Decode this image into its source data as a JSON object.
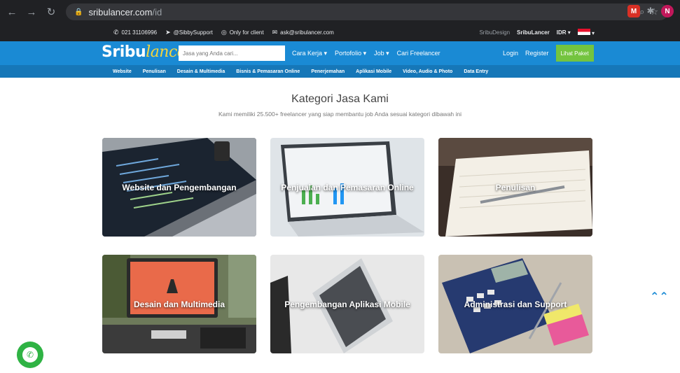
{
  "browser": {
    "url_host": "sribulancer.com",
    "url_path": "/id",
    "ext_avatar": "N"
  },
  "topbar": {
    "phone": "021 31106996",
    "telegram": "@SibbySupport",
    "whatsapp": "Only for client",
    "email": "ask@sribulancer.com",
    "sribudesign": "SribuDesign",
    "sribulancer": "SribuLancer",
    "currency": "IDR ▾"
  },
  "nav": {
    "logo_sribu": "Sribu",
    "logo_lancer": "lancer",
    "search_placeholder": "Jasa yang Anda cari...",
    "links": [
      "Cara Kerja ▾",
      "Portofolio ▾",
      "Job ▾",
      "Cari Freelancer"
    ],
    "login": "Login",
    "register": "Register",
    "paket": "Lihat Paket"
  },
  "categories_bar": [
    "Website",
    "Penulisan",
    "Desain & Multimedia",
    "Bisnis & Pemasaran Online",
    "Penerjemahan",
    "Aplikasi Mobile",
    "Video, Audio & Photo",
    "Data Entry"
  ],
  "main": {
    "title": "Kategori Jasa Kami",
    "subtitle": "Kami memiliki 25.500+ freelancer yang siap membantu job Anda sesuai kategori dibawah ini"
  },
  "cards": [
    {
      "label": "Website dan Pengembangan"
    },
    {
      "label": "Penjualan dan Pemasaran Online"
    },
    {
      "label": "Penulisan"
    },
    {
      "label": "Desain dan Multimedia"
    },
    {
      "label": "Pengembangan Aplikasi Mobile"
    },
    {
      "label": "Administrasi dan Support"
    }
  ],
  "colors": {
    "brand_blue": "#1a8ad4",
    "cat_blue": "#1677b8",
    "paket_green": "#74c43f",
    "whatsapp_green": "#2fb344"
  }
}
